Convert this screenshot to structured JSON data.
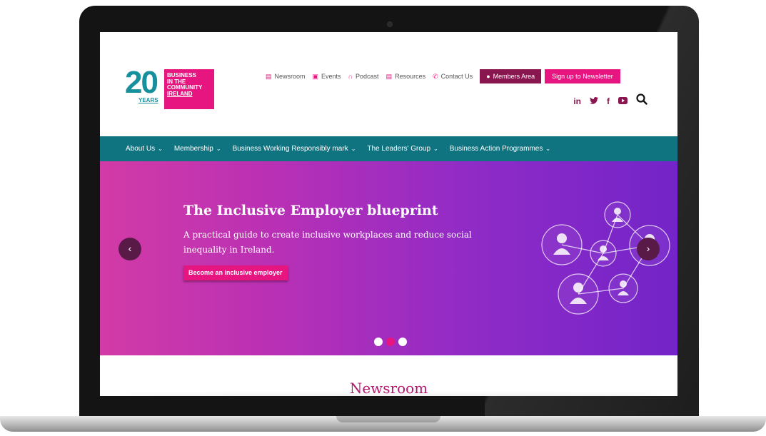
{
  "logo": {
    "number": "20",
    "years": "YEARS",
    "org_lines": [
      "BUSINESS",
      "IN THE",
      "COMMUNITY",
      "IRELAND"
    ]
  },
  "utility_nav": {
    "links": [
      {
        "icon": "document-icon",
        "label": "Newsroom"
      },
      {
        "icon": "calendar-icon",
        "label": "Events"
      },
      {
        "icon": "headphones-icon",
        "label": "Podcast"
      },
      {
        "icon": "document-icon",
        "label": "Resources"
      },
      {
        "icon": "phone-icon",
        "label": "Contact Us"
      }
    ],
    "members_label": "Members Area",
    "newsletter_label": "Sign up to Newsletter"
  },
  "social": {
    "icons": [
      "linkedin-icon",
      "twitter-icon",
      "facebook-icon",
      "youtube-icon"
    ],
    "linkedin_label": "in",
    "facebook_label": "f"
  },
  "main_nav": {
    "items": [
      {
        "label": "About Us"
      },
      {
        "label": "Membership"
      },
      {
        "label": "Business Working Responsibly mark"
      },
      {
        "label": "The Leaders' Group"
      },
      {
        "label": "Business Action Programmes"
      }
    ]
  },
  "hero": {
    "title": "The Inclusive Employer blueprint",
    "subtitle": "A practical guide to create inclusive workplaces and reduce social inequality in Ireland.",
    "cta_label": "Become an inclusive employer",
    "slides_count": 3,
    "active_slide": 2
  },
  "newsroom": {
    "title": "Newsroom"
  },
  "colors": {
    "brand_pink": "#e6157f",
    "brand_teal": "#15909c",
    "nav_teal": "#0f7380",
    "members_purple": "#8a1650"
  }
}
